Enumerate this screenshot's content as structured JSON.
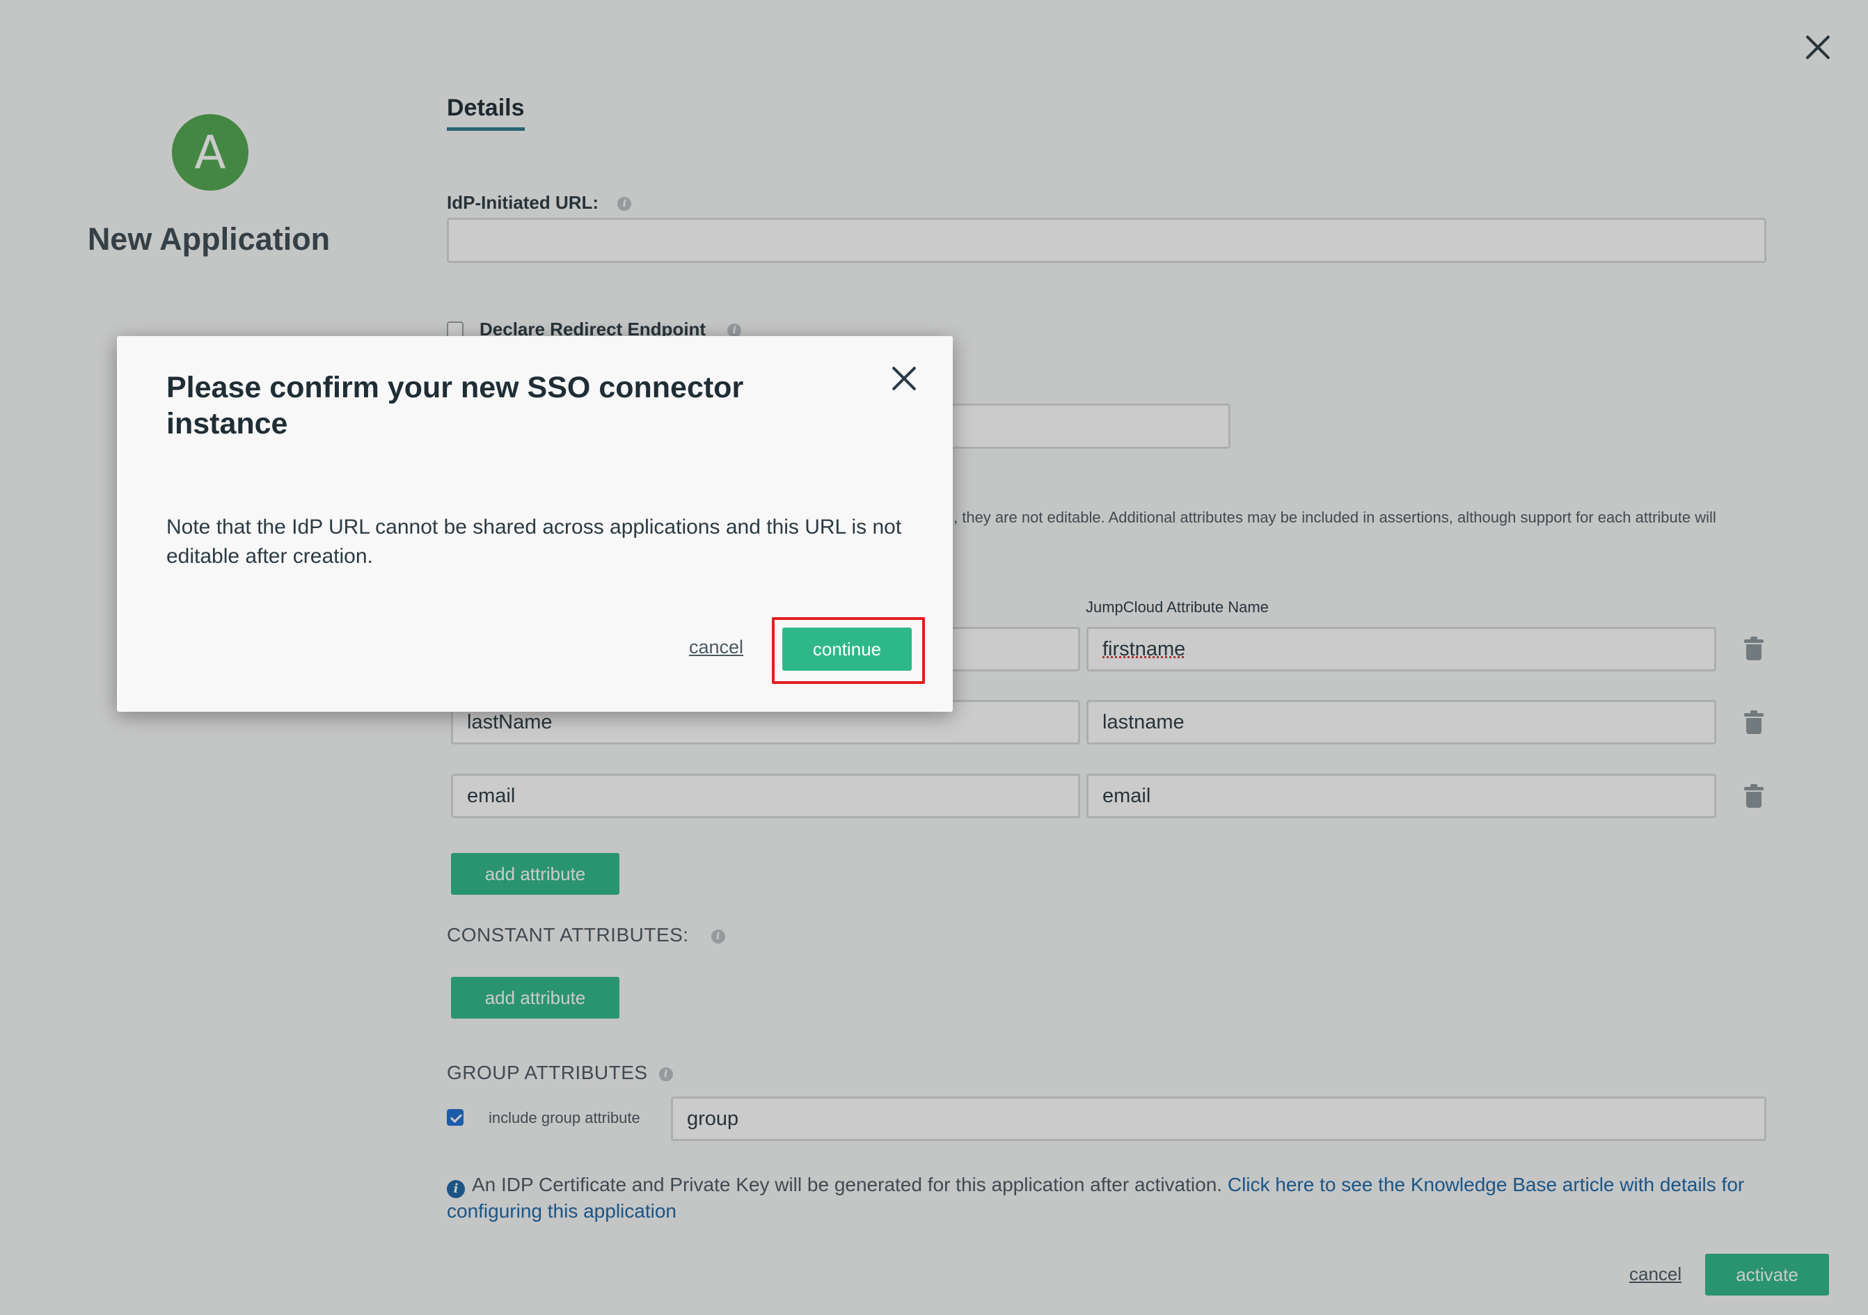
{
  "app": {
    "avatar_letter": "A",
    "name": "New Application"
  },
  "tabs": [
    {
      "label": "Details",
      "active": true
    }
  ],
  "form": {
    "idp_url_label": "IdP-Initiated URL:",
    "idp_url_value": "",
    "declare_redirect_label": "Declare Redirect Endpoint",
    "declare_redirect_checked": false,
    "attributes_note_partial": ", they are not editable. Additional attributes may be included in assertions, although support for each attribute will",
    "jumpcloud_attr_header": "JumpCloud Attribute Name",
    "attribute_rows": [
      {
        "service_attr": "",
        "jumpcloud_attr": "firstname"
      },
      {
        "service_attr": "lastName",
        "jumpcloud_attr": "lastname"
      },
      {
        "service_attr": "email",
        "jumpcloud_attr": "email"
      }
    ],
    "add_attribute_label": "add attribute",
    "constant_attributes_label": "CONSTANT ATTRIBUTES:",
    "constant_add_attribute_label": "add attribute",
    "group_attributes_label": "GROUP ATTRIBUTES",
    "include_group_label": "include group attribute",
    "include_group_checked": true,
    "group_value": "group",
    "cert_note": "An IDP Certificate and Private Key will be generated for this application after activation.",
    "kb_link_text": "Click here to see the Knowledge Base article with details for configuring this application"
  },
  "footer": {
    "cancel_label": "cancel",
    "activate_label": "activate"
  },
  "modal": {
    "title": "Please confirm your new SSO connector instance",
    "body": "Note that the IdP URL cannot be shared across applications and this URL is not editable after creation.",
    "cancel_label": "cancel",
    "continue_label": "continue"
  },
  "colors": {
    "accent_green": "#2eb88a",
    "avatar_green": "#4fa74e",
    "link_blue": "#1a66a6",
    "highlight_red": "#e02020"
  }
}
